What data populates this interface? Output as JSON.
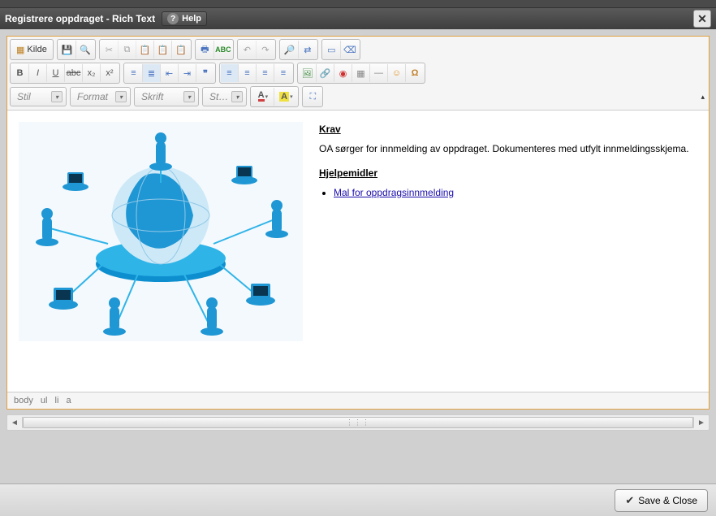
{
  "window": {
    "title": "Registrere oppdraget - Rich Text",
    "help_label": "Help",
    "help_symbol": "?"
  },
  "toolbar": {
    "source_label": "Kilde",
    "row1_groups": [
      [
        "source"
      ],
      [
        "save",
        "preview"
      ],
      [
        "cut",
        "copy",
        "paste",
        "paste-text",
        "paste-word"
      ],
      [
        "print",
        "spellcheck"
      ],
      [
        "undo",
        "redo"
      ],
      [
        "find",
        "replace"
      ],
      [
        "selectall",
        "remove-format"
      ]
    ],
    "dropdowns": {
      "style": "Stil",
      "format": "Format",
      "font": "Skrift",
      "size": "St…"
    }
  },
  "content": {
    "heading1": "Krav",
    "paragraph1": "OA sørger for innmelding av oppdraget. Dokumenteres med utfylt innmeldingsskjema.",
    "heading2": "Hjelpemidler",
    "link1": "Mal for oppdragsinnmelding"
  },
  "path": {
    "p1": "body",
    "p2": "ul",
    "p3": "li",
    "p4": "a"
  },
  "footer": {
    "save_close": "Save & Close"
  }
}
